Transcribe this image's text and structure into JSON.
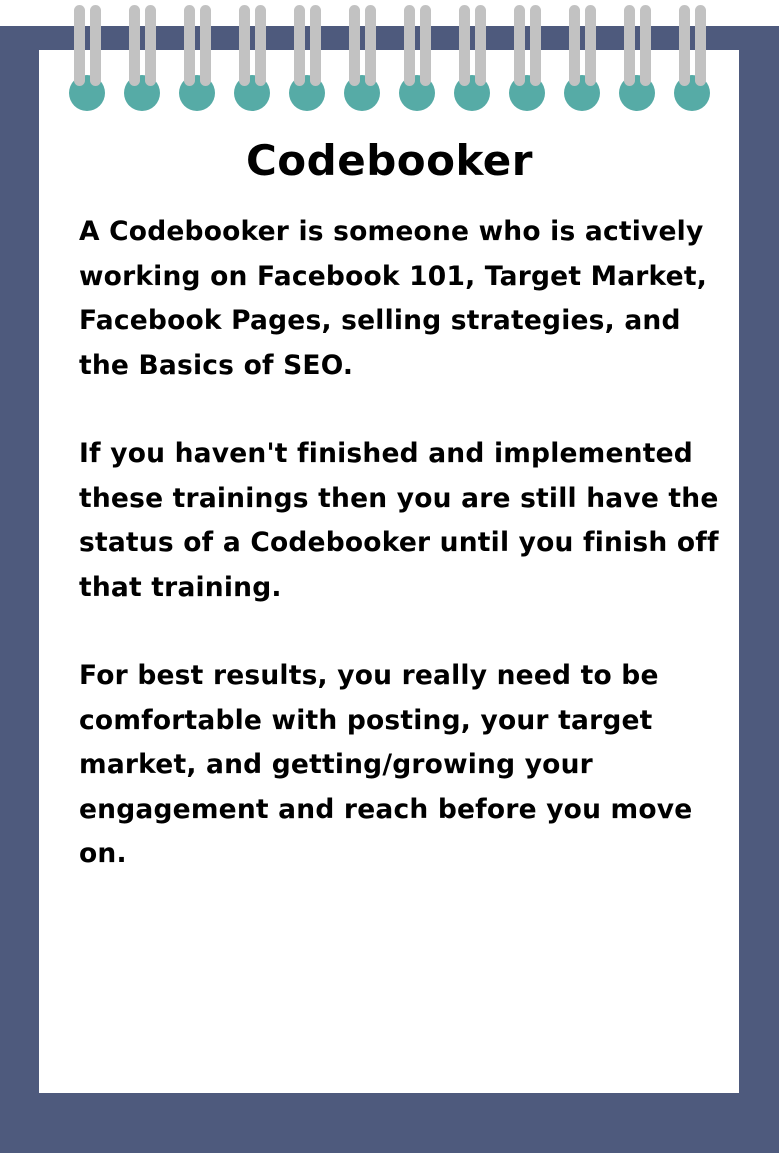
{
  "colors": {
    "frame": "#4e5a7d",
    "paper": "#ffffff",
    "ring_hole": "#56aba6",
    "ring_wire": "#c2c2c2",
    "text": "#000000"
  },
  "binding": {
    "ring_count": 12,
    "icon": "spiral-ring-icon"
  },
  "title": "Codebooker",
  "paragraphs": [
    "A Codebooker is someone who is actively working on Facebook 101, Target Market, Facebook Pages, selling strategies, and the Basics of SEO.",
    "If you haven't finished and implemented these trainings then you are still have the status of a Codebooker until you finish off that training.",
    "For best results, you really need to be comfortable with posting, your target market, and getting/growing your engagement and reach before you move on."
  ]
}
